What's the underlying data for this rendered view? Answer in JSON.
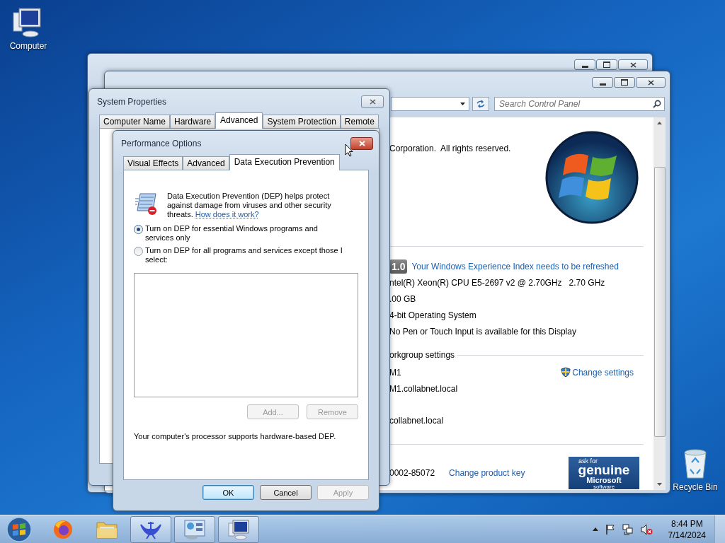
{
  "desktop_icons": [
    {
      "label": "Computer",
      "kind": "computer"
    },
    {
      "label": "Recycle Bin",
      "kind": "recycle"
    }
  ],
  "control_panel": {
    "search": {
      "placeholder": "Search Control Panel"
    },
    "copyright": "Corporation.  All rights reserved.",
    "rating": {
      "score": "1.0",
      "link": "Your Windows Experience Index needs to be refreshed"
    },
    "system_rows": [
      "ntel(R) Xeon(R) CPU E5-2697 v2 @ 2.70GHz   2.70 GHz",
      ".00 GB",
      "4-bit Operating System",
      "No Pen or Touch Input is available for this Display"
    ],
    "section": "orkgroup settings",
    "computer_rows": [
      "M1",
      "M1.collabnet.local",
      "",
      "collabnet.local"
    ],
    "change_settings": "Change settings",
    "product_id": "0002-85072",
    "change_key": "Change product key",
    "genuine_logo": [
      "ask for",
      "genuine",
      "Microsoft",
      "software"
    ]
  },
  "system_properties": {
    "title": "System Properties",
    "tabs": [
      {
        "label": "Computer Name",
        "selected": false
      },
      {
        "label": "Hardware",
        "selected": false
      },
      {
        "label": "Advanced",
        "selected": true
      },
      {
        "label": "System Protection",
        "selected": false
      },
      {
        "label": "Remote",
        "selected": false
      }
    ]
  },
  "performance_options": {
    "title": "Performance Options",
    "tabs": [
      {
        "label": "Visual Effects",
        "selected": false
      },
      {
        "label": "Advanced",
        "selected": false
      },
      {
        "label": "Data Execution Prevention",
        "selected": true
      }
    ],
    "description": "Data Execution Prevention (DEP) helps protect against damage from viruses and other security threats.",
    "help_link": "How does it work?",
    "options": [
      {
        "label": "Turn on DEP for essential Windows programs and services only",
        "selected": true
      },
      {
        "label": "Turn on DEP for all programs and services except those I select:",
        "selected": false
      }
    ],
    "list_buttons": [
      {
        "label": "Add...",
        "disabled": true
      },
      {
        "label": "Remove",
        "disabled": true
      }
    ],
    "status": "Your computer's processor supports hardware-based DEP.",
    "buttons": [
      {
        "label": "OK",
        "default": true,
        "disabled": false
      },
      {
        "label": "Cancel",
        "default": false,
        "disabled": false
      },
      {
        "label": "Apply",
        "default": false,
        "disabled": true
      }
    ]
  },
  "taskbar": {
    "items": [
      {
        "kind": "firefox",
        "running": false
      },
      {
        "kind": "folder",
        "running": false
      },
      {
        "kind": "bird",
        "running": true
      },
      {
        "kind": "control-panel",
        "running": true
      },
      {
        "kind": "computer",
        "running": true
      }
    ],
    "clock": {
      "time": "8:44 PM",
      "date": "7/14/2024"
    }
  }
}
